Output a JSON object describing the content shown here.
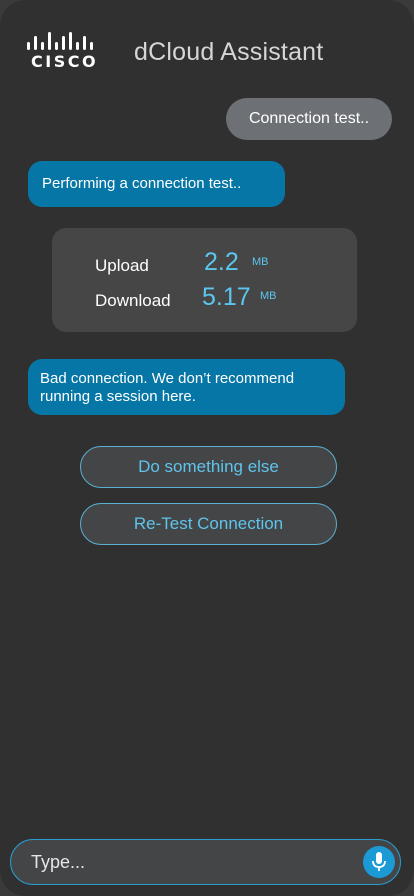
{
  "header": {
    "logo_text": "CISCO",
    "title": "dCloud Assistant"
  },
  "messages": {
    "user_1": "Connection test..",
    "bot_1": "Performing a connection test..",
    "bot_2": "Bad connection. We don’t recommend running a session here."
  },
  "speed_test": {
    "upload_label": "Upload",
    "upload_value": "2.2",
    "upload_unit": "MB",
    "download_label": "Download",
    "download_value": "5.17",
    "download_unit": "MB"
  },
  "actions": {
    "do_something_else": "Do something else",
    "retest": "Re-Test Connection"
  },
  "composer": {
    "placeholder": "Type...",
    "mic_icon": "microphone-icon"
  },
  "colors": {
    "background": "#303030",
    "bot_bubble": "#0676a6",
    "user_bubble": "#6d7176",
    "accent": "#5bc7ef",
    "mic": "#1b9ad6"
  }
}
